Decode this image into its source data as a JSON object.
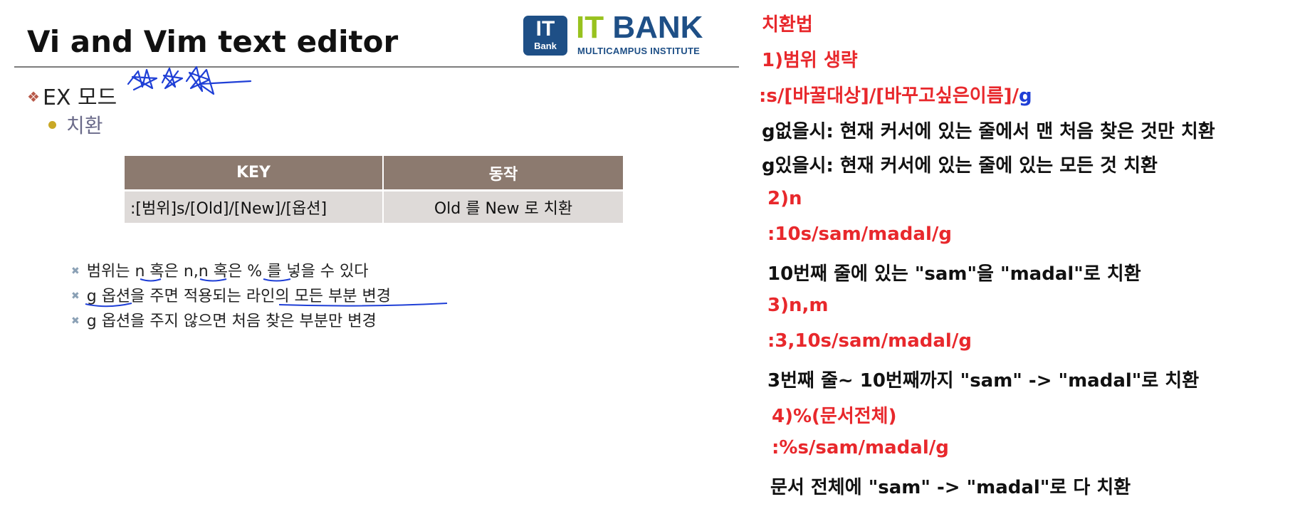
{
  "slide": {
    "title": "Vi and Vim text editor",
    "logo": {
      "badge_top": "IT",
      "badge_bottom": "Bank",
      "name_green": "IT",
      "name_blue": "BANK",
      "subtitle": "MULTICAMPUS INSTITUTE"
    },
    "bullet_level1": "EX 모드",
    "bullet_level2": "치환",
    "table": {
      "headers": [
        "KEY",
        "동작"
      ],
      "rows": [
        [
          ":[범위]s/[Old]/[New]/[옵션]",
          "Old 를 New 로 치환"
        ]
      ]
    },
    "notes": [
      "범위는 n 혹은 n,n 혹은 % 를 넣을 수 있다",
      "g 옵션을 주면 적용되는 라인의 모든 부분 변경",
      "g 옵션을 주지 않으면 처음 찾은 부분만 변경"
    ],
    "colors": {
      "accent_red": "#e8282c",
      "table_header": "#8c7a6f",
      "table_row": "#dedad8",
      "logo_blue": "#1e4f86",
      "logo_green": "#98c21f",
      "ink_blue": "#1f3fd6"
    }
  },
  "side_notes": {
    "heading": "치환법",
    "s1_title": "1)범위 생략",
    "s1_cmd_main": ":s/[바꿀대상]/[바꾸고싶은이름]/",
    "s1_cmd_flag": "g",
    "s1_desc1": "g없을시: 현재 커서에 있는 줄에서 맨 처음 찾은 것만 치환",
    "s1_desc2": "g있을시: 현재 커서에 있는 줄에 있는 모든 것 치환",
    "s2_title": "2)n",
    "s2_cmd": ":10s/sam/madal/g",
    "s2_desc": "10번째 줄에 있는 \"sam\"을 \"madal\"로 치환",
    "s3_title": "3)n,m",
    "s3_cmd": ":3,10s/sam/madal/g",
    "s3_desc": "3번째 줄~ 10번째까지 \"sam\" -> \"madal\"로 치환",
    "s4_title": "4)%(문서전체)",
    "s4_cmd": ":%s/sam/madal/g",
    "s4_desc": "문서 전체에 \"sam\" -> \"madal\"로 다 치환"
  }
}
